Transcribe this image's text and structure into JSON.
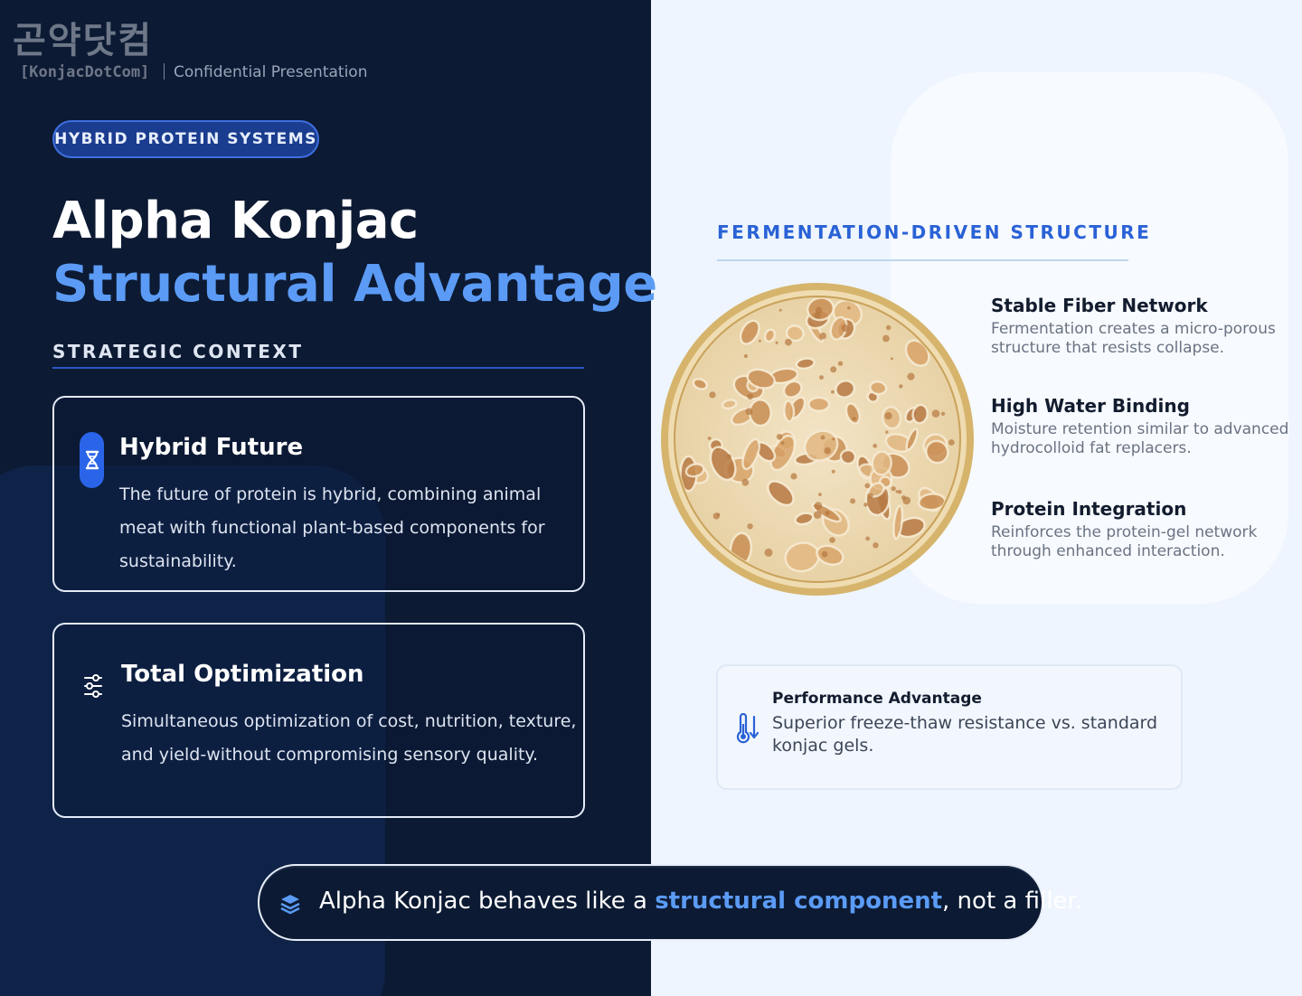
{
  "logo": {
    "korean": "곤약닷컴",
    "english": "[KonjacDotCom]"
  },
  "header": {
    "confidential": "Confidential Presentation"
  },
  "pill_label": "HYBRID PROTEIN SYSTEMS",
  "title": {
    "line1": "Alpha Konjac",
    "line2": "Structural Advantage"
  },
  "strategic_context": "STRATEGIC CONTEXT",
  "cards": [
    {
      "title": "Hybrid Future",
      "body": "The future of protein is hybrid, combining animal meat with functional plant-based components for sustainability.",
      "icon": "hourglass-dna-icon"
    },
    {
      "title": "Total Optimization",
      "body": "Simultaneous optimization of cost, nutrition, texture, and yield-without compromising sensory quality.",
      "icon": "sliders-icon"
    }
  ],
  "fermentation": {
    "heading": "FERMENTATION-DRIVEN STRUCTURE",
    "features": [
      {
        "title": "Stable Fiber Network",
        "body": "Fermentation creates a micro-porous structure that resists collapse."
      },
      {
        "title": "High Water Binding",
        "body": "Moisture retention similar to advanced hydrocolloid fat replacers."
      },
      {
        "title": "Protein Integration",
        "body": "Reinforces the protein-gel network through enhanced interaction."
      }
    ]
  },
  "performance": {
    "title": "Performance Advantage",
    "body": "Superior freeze-thaw resistance vs. standard konjac gels.",
    "icon": "thermometer-down-icon"
  },
  "banner": {
    "prefix": "Alpha Konjac behaves like a ",
    "highlight": "structural component",
    "suffix": ", not a filler.",
    "icon": "layers-icon"
  },
  "colors": {
    "navy": "#0c1a33",
    "accent": "#5b9bf5",
    "accent_dark": "#2a62d6",
    "light_bg": "#eef5fe"
  }
}
